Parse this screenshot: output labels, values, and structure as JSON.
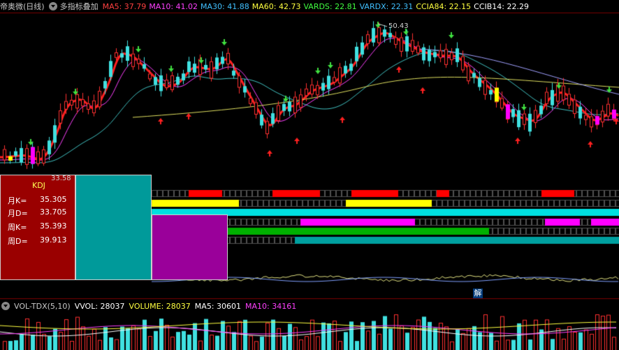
{
  "header": {
    "stock_name": "帝奥微(日线)",
    "indicator_name": "多指标叠加",
    "ma5": "MA5: 37.79",
    "ma10": "MA10: 41.02",
    "ma30": "MA30: 41.88",
    "ma60": "MA60: 42.73",
    "vards": "VARDS: 22.81",
    "vardx": "VARDX: 22.31",
    "ccia84": "CCIA84: 22.15",
    "ccib14": "CCIB14: 22.29",
    "colors": {
      "ma5": "#ff4040",
      "ma10": "#ff40ff",
      "ma30": "#40c0ff",
      "ma60": "#ffff40",
      "vards": "#40ff40",
      "vardx": "#40c0ff",
      "ccia84": "#ffff40",
      "ccib14": "#ffffff"
    }
  },
  "price_labels": {
    "high": "50.43",
    "low": "33.58"
  },
  "kdj": {
    "title": "KDJ",
    "rows": [
      {
        "label": "月K=",
        "value": "35.305"
      },
      {
        "label": "月D=",
        "value": "33.705"
      },
      {
        "label": "周K=",
        "value": "35.393"
      },
      {
        "label": "周D=",
        "value": "39.913"
      }
    ]
  },
  "volume_header": {
    "name": "VOL-TDX(5,10)",
    "vvol": "VVOL: 28037",
    "volume": "VOLUME: 28037",
    "ma5": "MA5: 30601",
    "ma10": "MA10: 34161"
  },
  "jie_label": "解"
}
